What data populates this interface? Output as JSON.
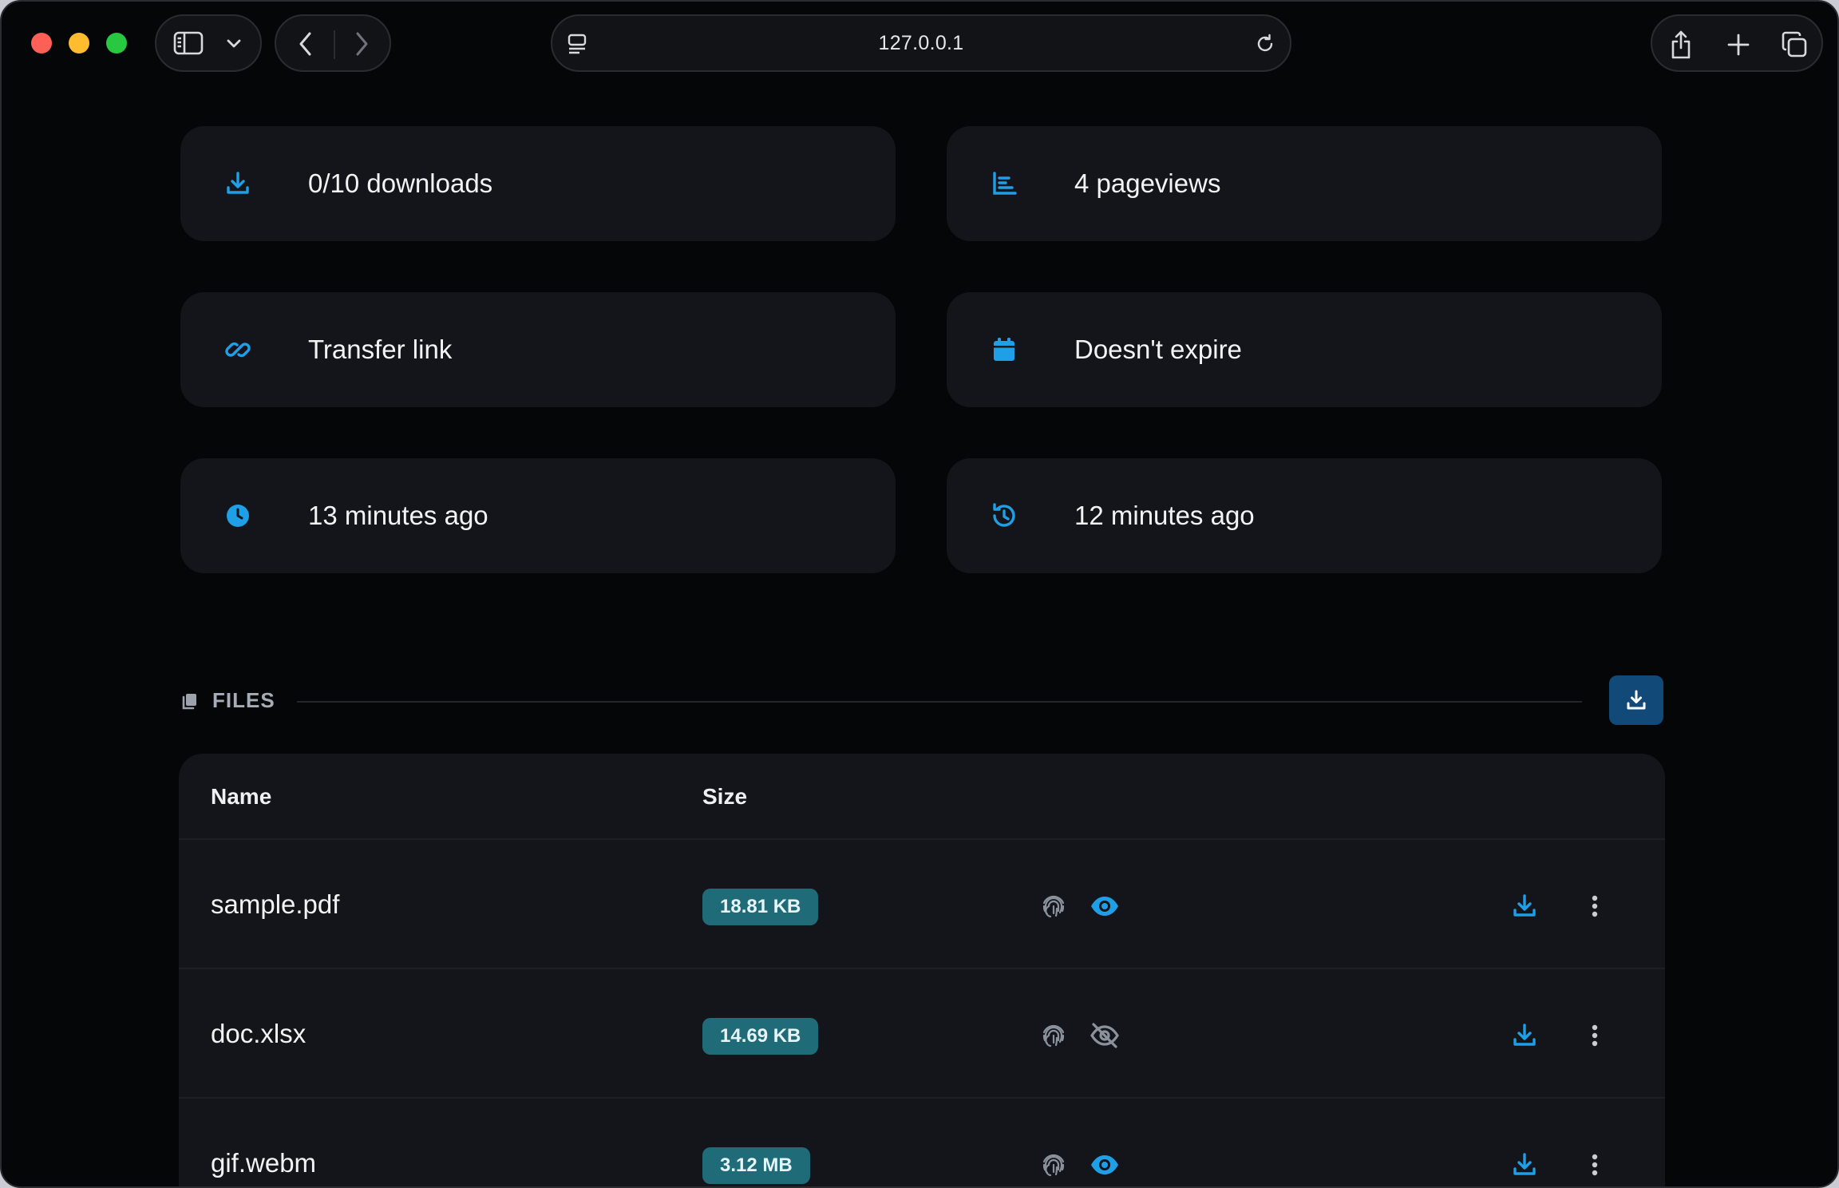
{
  "browser": {
    "url": "127.0.0.1"
  },
  "stats": {
    "downloads": "0/10 downloads",
    "pageviews": "4 pageviews",
    "link": "Transfer link",
    "expiry": "Doesn't expire",
    "created": "13 minutes ago",
    "updated": "12 minutes ago"
  },
  "files": {
    "section_label": "FILES",
    "columns": {
      "name": "Name",
      "size": "Size"
    },
    "rows": [
      {
        "name": "sample.pdf",
        "size": "18.81 KB",
        "visible": true
      },
      {
        "name": "doc.xlsx",
        "size": "14.69 KB",
        "visible": false
      },
      {
        "name": "gif.webm",
        "size": "3.12 MB",
        "visible": true
      }
    ]
  },
  "colors": {
    "accent": "#1e9fe6",
    "card_bg": "#13151b",
    "badge_bg": "#1f6c78",
    "button_bg": "#114a78",
    "page_bg": "#050608"
  }
}
